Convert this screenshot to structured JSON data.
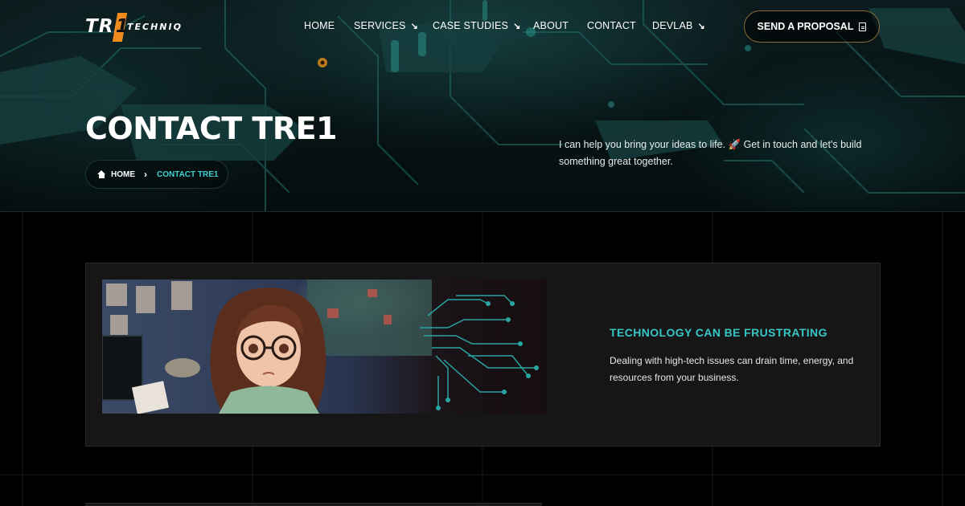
{
  "brand": {
    "logo_tre": "TRE",
    "logo_one": "1",
    "logo_techniq": "TECHNIQ",
    "accent": "#f08a1d",
    "teal": "#3fd1d1"
  },
  "nav": {
    "items": [
      {
        "label": "HOME",
        "icon": ""
      },
      {
        "label": "SERVICES",
        "icon": "↘"
      },
      {
        "label": "CASE STUDIES",
        "icon": "↘"
      },
      {
        "label": "ABOUT",
        "icon": ""
      },
      {
        "label": "CONTACT",
        "icon": ""
      },
      {
        "label": "DEVLAB",
        "icon": "↘"
      }
    ],
    "cta_label": "SEND A PROPOSAL",
    "cta_icon": "document-icon"
  },
  "hero": {
    "title": "CONTACT TRE1",
    "description": "I can help you bring your ideas to life. 🚀 Get in touch and let's build something great together.",
    "breadcrumb": {
      "home": "HOME",
      "separator": "›",
      "current": "CONTACT TRE1"
    }
  },
  "card": {
    "title": "TECHNOLOGY CAN BE FRUSTRATING",
    "text": "Dealing with high-tech issues can drain time, energy, and resources from your business."
  }
}
